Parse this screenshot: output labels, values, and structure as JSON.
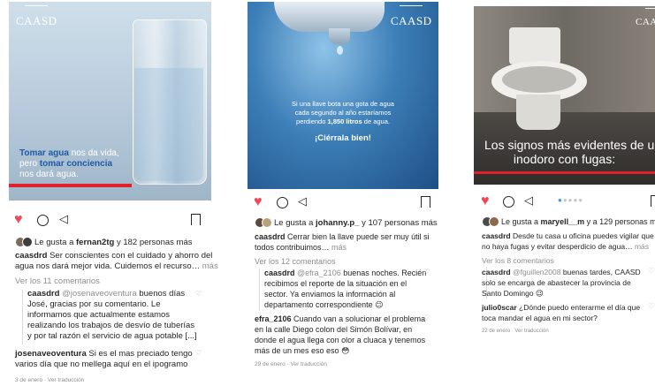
{
  "brand": "CAASD",
  "colors": {
    "like_red": "#ed4956",
    "brand_blue": "#1e5aa8",
    "accent_red": "#e0202a"
  },
  "posts": [
    {
      "image_line1_a": "Tomar agua",
      "image_line1_b": " nos da vida,",
      "image_line2_a": "pero ",
      "image_line2_b": "tomar conciencia",
      "image_line3": "nos dará agua.",
      "likes_prefix": "Le gusta a ",
      "likes_user": "fernan2tg",
      "likes_suffix": " y 182 personas más",
      "caption_user": "caasdrd",
      "caption_l1": " Ser conscientes con el cuidado y ahorro del",
      "caption_l2": "agua nos dará mejor vida. Cuidemos el recurso…",
      "more": " más",
      "view_comments": "Ver los 11 comentarios",
      "reply_user": "caasdrd",
      "reply_mention": " @josenaveoventura",
      "reply_l1_rest": " buenos días",
      "reply_l2": "José, gracias por su comentario. Le",
      "reply_l3": "informamos que actualmente estamos",
      "reply_l4": "realizando los trabajos de desvío de tuberías",
      "reply_l5": "y por tal razón el servicio de agua potable [...]",
      "comment_user": "josenaveoventura",
      "comment_l1_rest": " Si es el mas preciado tengo",
      "comment_l2": "varios día que no mellega aquí en el ipogramo",
      "date": "3 de enero · Ver traducción"
    },
    {
      "image_text_l1": "Si una llave bota una gota de agua",
      "image_text_l2": "cada segundo al año estaríamos",
      "image_text_l3_a": "perdiendo ",
      "image_text_l3_b": "1,850 litros",
      "image_text_l3_c": " de agua.",
      "image_cta": "¡Ciérrala bien!",
      "likes_prefix": "Le gusta a ",
      "likes_user": "johanny.p_",
      "likes_suffix": " y 107 personas más",
      "caption_user": "caasdrd",
      "caption_l1": " Cerrar bien la llave puede ser muy útil si",
      "caption_l2": "todos contribuimos…",
      "more": " más",
      "view_comments": "Ver los 12 comentarios",
      "reply_user": "caasdrd",
      "reply_mention": " @efra_2106",
      "reply_l1_rest": " buenas noches. Recién",
      "reply_l2": "recibimos el reporte de la situación en el",
      "reply_l3": "sector. Ya enviamos la información al",
      "reply_l4": "departamento correspondiente 😉",
      "comment_user": "efra_2106",
      "comment_l1_rest": " Cuando van a solucionar el problema",
      "comment_l2": "en la calle Diego colon del Simón Bolívar, en",
      "comment_l3": "donde el agua llega con olor a cluaca y tenemos",
      "comment_l4": "más de un mes eso eso 😳",
      "date": "29 de enero · Ver traducción"
    },
    {
      "image_text_l1": "Los signos más evidentes de un",
      "image_text_l2": "inodoro con fugas:",
      "likes_prefix": "Le gusta a ",
      "likes_user": "maryell__m",
      "likes_suffix": " y a 129 personas más",
      "caption_user": "caasdrd",
      "caption_l1": " Desde tu casa u oficina puedes vigilar que",
      "caption_l2": "no haya fugas y evitar desperdicio de agua…",
      "more": " más",
      "view_comments": "Ver los 8 comentarios",
      "reply_user": "caasdrd",
      "reply_mention": " @fguillen2008",
      "reply_l1_rest": " buenas tardes, CAASD",
      "reply_l2": "solo se encarga de abastecer la provincia de",
      "reply_l3": "Santo Domingo 😉",
      "comment_user": "julio0scar",
      "comment_l1_rest": " ¿Dónde puedo enterarme el día que",
      "comment_l2": "toca mandar el agua en mi sector?",
      "date": "22 de enero · Ver traducción"
    }
  ]
}
